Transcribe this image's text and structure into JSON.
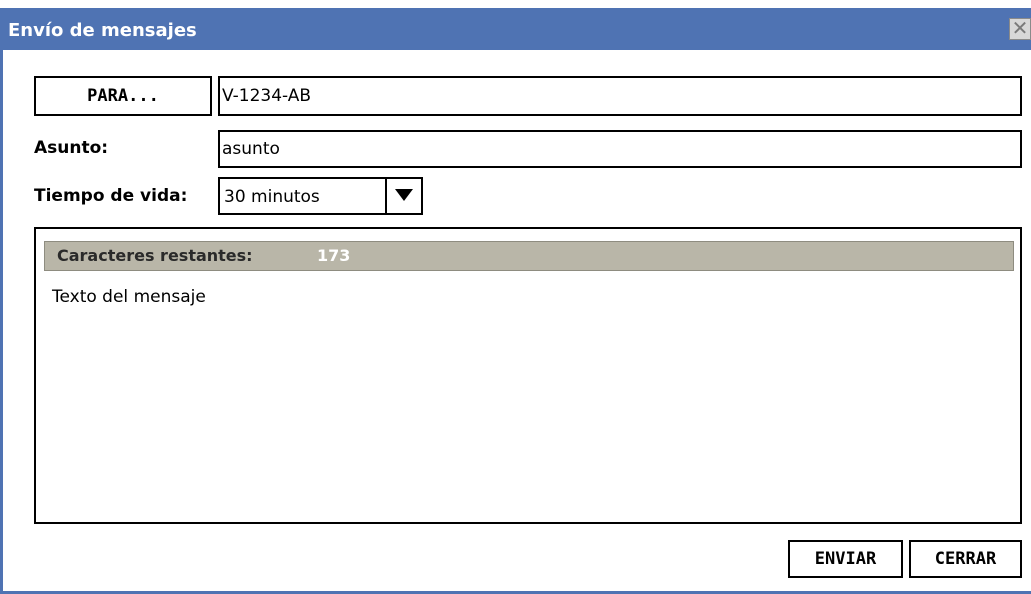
{
  "window": {
    "title": "Envío de mensajes",
    "close_glyph": "✕"
  },
  "form": {
    "para_button": "PARA...",
    "para_value": "V-1234-AB",
    "asunto_label": "Asunto:",
    "asunto_value": "asunto",
    "tiempo_label": "Tiempo de vida:",
    "tiempo_value": "30 minutos"
  },
  "message": {
    "counter_label": "Caracteres restantes:",
    "counter_value": "173",
    "body": "Texto del mensaje"
  },
  "actions": {
    "send_label": "ENVIAR",
    "close_label": "CERRAR"
  },
  "colors": {
    "titlebar": "#4f73b3",
    "counter_bar": "#b9b6a8"
  },
  "icons": {
    "close": "close-icon",
    "dropdown": "chevron-down-icon"
  }
}
